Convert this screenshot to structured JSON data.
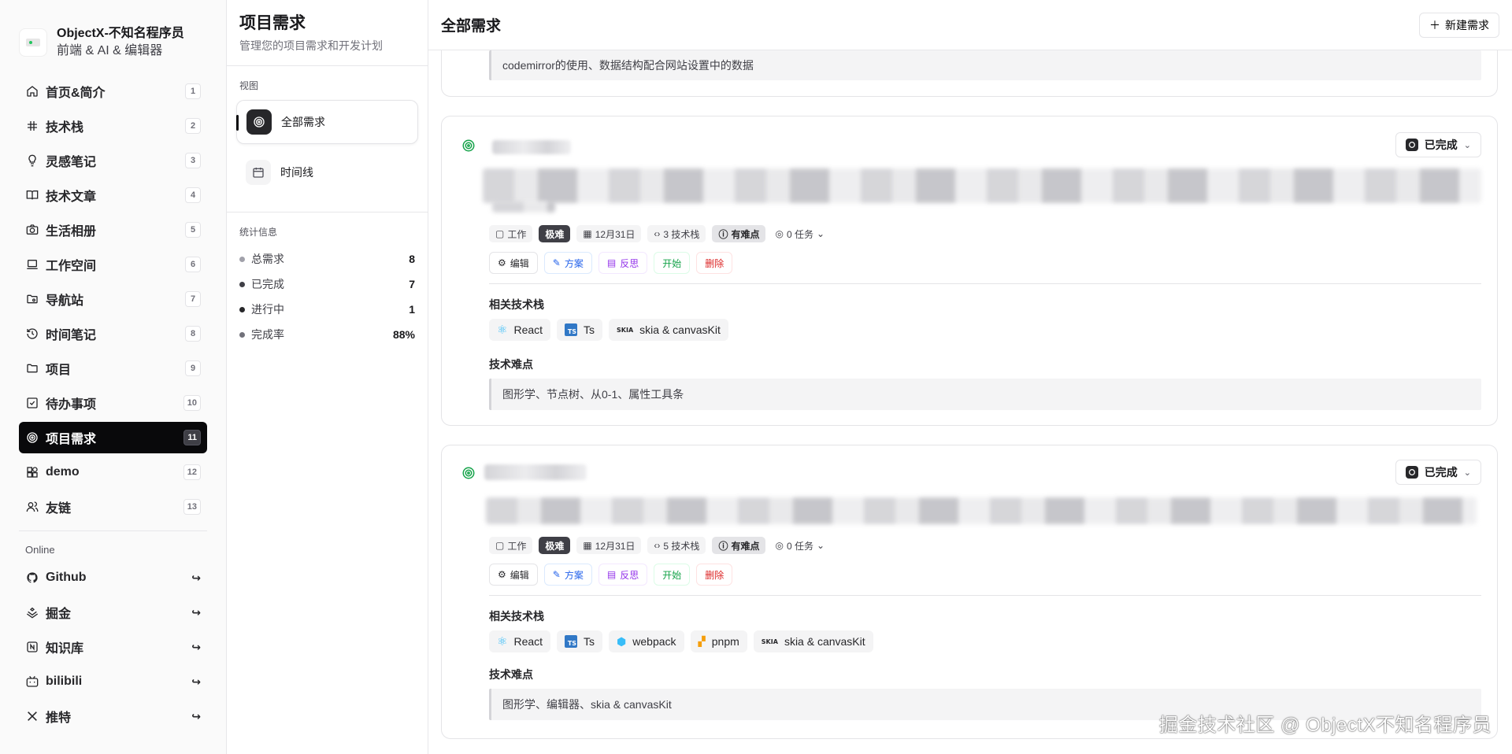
{
  "brand": {
    "title": "ObjectX-不知名程序员",
    "subtitle": "前端 & AI & 编辑器"
  },
  "nav": [
    {
      "label": "首页&简介",
      "key": "1",
      "icon": "home-icon"
    },
    {
      "label": "技术栈",
      "key": "2",
      "icon": "hash-icon"
    },
    {
      "label": "灵感笔记",
      "key": "3",
      "icon": "lightbulb-icon"
    },
    {
      "label": "技术文章",
      "key": "4",
      "icon": "book-icon"
    },
    {
      "label": "生活相册",
      "key": "5",
      "icon": "camera-icon"
    },
    {
      "label": "工作空间",
      "key": "6",
      "icon": "laptop-icon"
    },
    {
      "label": "导航站",
      "key": "7",
      "icon": "folder-search-icon"
    },
    {
      "label": "时间笔记",
      "key": "8",
      "icon": "history-icon"
    },
    {
      "label": "项目",
      "key": "9",
      "icon": "folder-icon"
    },
    {
      "label": "待办事项",
      "key": "10",
      "icon": "checkbox-icon"
    },
    {
      "label": "项目需求",
      "key": "11",
      "icon": "target-icon",
      "active": true
    },
    {
      "label": "demo",
      "key": "12",
      "icon": "shapes-icon"
    },
    {
      "label": "友链",
      "key": "13",
      "icon": "users-icon"
    }
  ],
  "online": {
    "title": "Online",
    "items": [
      {
        "label": "Github",
        "icon": "github-icon"
      },
      {
        "label": "掘金",
        "icon": "juejin-icon"
      },
      {
        "label": "知识库",
        "icon": "notion-icon"
      },
      {
        "label": "bilibili",
        "icon": "bilibili-icon"
      },
      {
        "label": "推特",
        "icon": "x-icon"
      }
    ]
  },
  "panel": {
    "title": "项目需求",
    "subtitle": "管理您的项目需求和开发计划",
    "views_title": "视图",
    "views": [
      {
        "label": "全部需求",
        "active": true
      },
      {
        "label": "时间线"
      }
    ],
    "stats_title": "统计信息",
    "stats": [
      {
        "label": "总需求",
        "value": "8"
      },
      {
        "label": "已完成",
        "value": "7"
      },
      {
        "label": "进行中",
        "value": "1"
      },
      {
        "label": "完成率",
        "value": "88%"
      }
    ]
  },
  "main": {
    "title": "全部需求",
    "new_button": "新建需求",
    "partial_card_quote": "codemirror的使用、数据结构配合网站设置中的数据",
    "cards": [
      {
        "status": "已完成",
        "tags": {
          "category": "工作",
          "difficulty": "极难",
          "date": "12月31日",
          "stack": "3 技术栈",
          "hard": "有难点",
          "tasks": "0 任务"
        },
        "actions": {
          "edit": "编辑",
          "plan": "方案",
          "reflect": "反思",
          "start": "开始",
          "delete": "删除"
        },
        "stack_title": "相关技术栈",
        "stack": [
          "React",
          "Ts",
          "skia & canvasKit"
        ],
        "difficulty_title": "技术难点",
        "difficulty_text": "图形学、节点树、从0-1、属性工具条"
      },
      {
        "status": "已完成",
        "tags": {
          "category": "工作",
          "difficulty": "极难",
          "date": "12月31日",
          "stack": "5 技术栈",
          "hard": "有难点",
          "tasks": "0 任务"
        },
        "actions": {
          "edit": "编辑",
          "plan": "方案",
          "reflect": "反思",
          "start": "开始",
          "delete": "删除"
        },
        "stack_title": "相关技术栈",
        "stack": [
          "React",
          "Ts",
          "webpack",
          "pnpm",
          "skia & canvasKit"
        ],
        "difficulty_title": "技术难点",
        "difficulty_text": "图形学、编辑器、skia & canvasKit"
      }
    ]
  },
  "watermark": "掘金技术社区 @ ObjectX不知名程序员"
}
